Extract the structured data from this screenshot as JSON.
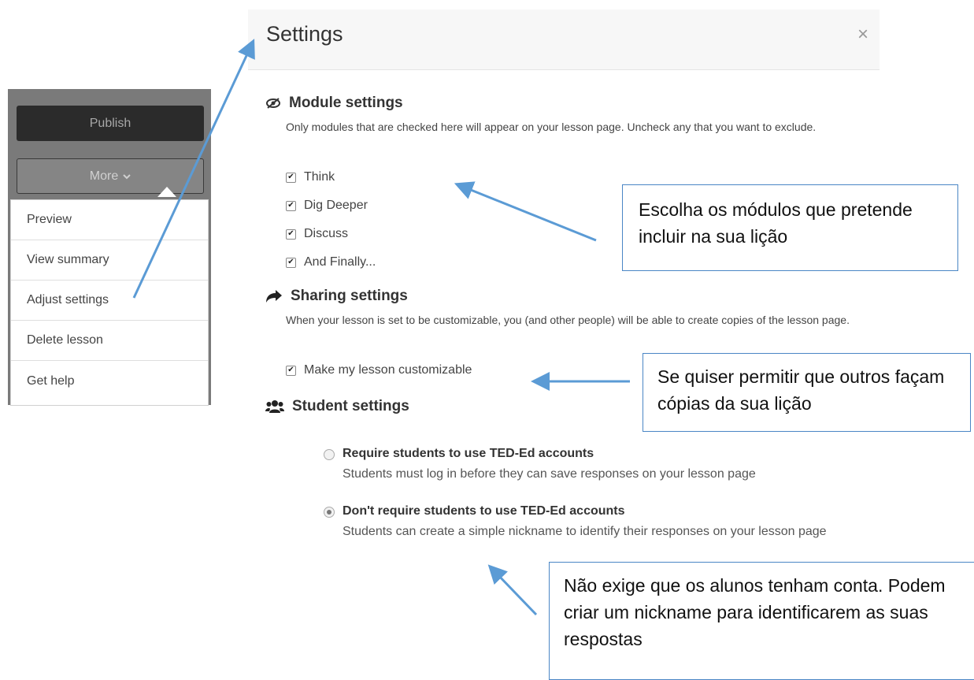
{
  "toolbar": {
    "publish_label": "Publish",
    "more_label": "More"
  },
  "menu": {
    "items": [
      {
        "label": "Preview"
      },
      {
        "label": "View summary"
      },
      {
        "label": "Adjust settings"
      },
      {
        "label": "Delete lesson"
      },
      {
        "label": "Get help"
      }
    ]
  },
  "modal": {
    "title": "Settings",
    "close_symbol": "×"
  },
  "module_settings": {
    "title": "Module settings",
    "description": "Only modules that are checked here will appear on your lesson page. Uncheck any that you want to exclude.",
    "options": [
      {
        "label": "Think",
        "checked": true
      },
      {
        "label": "Dig Deeper",
        "checked": true
      },
      {
        "label": "Discuss",
        "checked": true
      },
      {
        "label": "And Finally...",
        "checked": true
      }
    ]
  },
  "sharing_settings": {
    "title": "Sharing settings",
    "description": "When your lesson is set to be customizable, you (and other people) will be able to create copies of the lesson page.",
    "option": {
      "label": "Make my lesson customizable",
      "checked": true
    }
  },
  "student_settings": {
    "title": "Student settings",
    "options": [
      {
        "label": "Require students to use TED-Ed accounts",
        "description": "Students must log in before they can save responses on your lesson page",
        "selected": false
      },
      {
        "label": "Don't require students to use TED-Ed accounts",
        "description": "Students can create a simple nickname to identify their responses on your lesson page",
        "selected": true
      }
    ]
  },
  "callouts": {
    "modules": "Escolha os módulos que pretende incluir na sua lição",
    "sharing": "Se quiser permitir que outros façam cópias da sua lição",
    "accounts": "Não exige que os alunos tenham conta. Podem criar um nickname para identificarem as suas respostas"
  },
  "colors": {
    "callout_border": "#4a86c5",
    "arrow": "#5b9bd5",
    "publish_bg": "#2b2b2b",
    "toolbar_bg": "#7a7a7a"
  }
}
